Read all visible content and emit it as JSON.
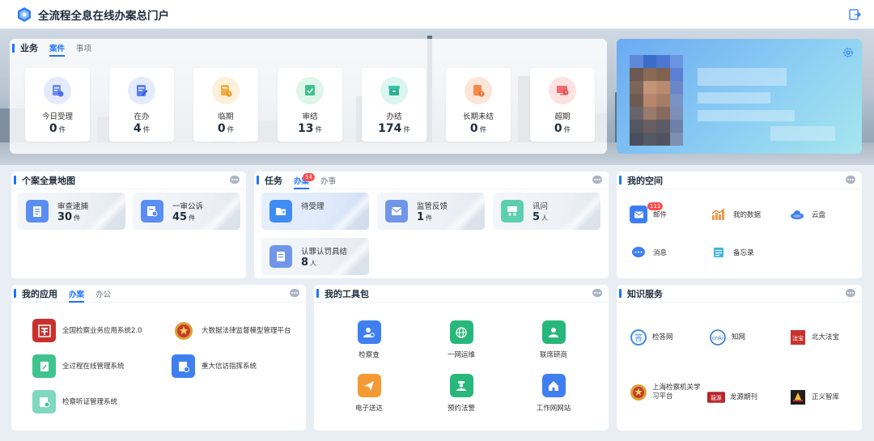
{
  "header": {
    "title": "全流程全息在线办案总门户",
    "logo_icon": "hexagon-logo-icon",
    "exit_icon": "logout-icon"
  },
  "business": {
    "title": "业务",
    "tabs": [
      "案件",
      "事项"
    ],
    "stats": [
      {
        "label": "今日受理",
        "value": "0",
        "unit": "件",
        "color": "#6b8cf2"
      },
      {
        "label": "在办",
        "value": "4",
        "unit": "件",
        "color": "#5b7ff0"
      },
      {
        "label": "临期",
        "value": "0",
        "unit": "件",
        "color": "#f0b046"
      },
      {
        "label": "审结",
        "value": "13",
        "unit": "件",
        "color": "#3ec28f"
      },
      {
        "label": "办结",
        "value": "174",
        "unit": "件",
        "color": "#38c3a4"
      },
      {
        "label": "长期未结",
        "value": "0",
        "unit": "件",
        "color": "#f48a4a"
      },
      {
        "label": "超期",
        "value": "0",
        "unit": "件",
        "color": "#f06b6b"
      }
    ]
  },
  "case_map": {
    "title": "个案全景地图",
    "items": [
      {
        "label": "审查逮捕",
        "value": "30",
        "unit": "件"
      },
      {
        "label": "一审公诉",
        "value": "45",
        "unit": "件"
      }
    ]
  },
  "tasks": {
    "title": "任务",
    "tabs": [
      "办案",
      "办事"
    ],
    "tab_badge": "14",
    "items": [
      {
        "label": "待受理",
        "value": "",
        "unit": ""
      },
      {
        "label": "监管反馈",
        "value": "1",
        "unit": "件"
      },
      {
        "label": "讯问",
        "value": "5",
        "unit": "人"
      },
      {
        "label": "认罪认罚具结",
        "value": "8",
        "unit": "人"
      }
    ]
  },
  "my_space": {
    "title": "我的空间",
    "items": [
      {
        "label": "邮件",
        "badge": "111"
      },
      {
        "label": "我的数据"
      },
      {
        "label": "云盘"
      },
      {
        "label": "消息"
      },
      {
        "label": "备忘录"
      }
    ]
  },
  "my_apps": {
    "title": "我的应用",
    "tabs": [
      "办案",
      "办公"
    ],
    "items": [
      {
        "label": "全国检察业务应用系统2.0"
      },
      {
        "label": "大数据法律监督模型管理平台"
      },
      {
        "label": "全过程在线管理系统"
      },
      {
        "label": "重大信访指挥系统"
      },
      {
        "label": "检察听证管理系统"
      }
    ]
  },
  "toolkit": {
    "title": "我的工具包",
    "items": [
      {
        "label": "检察查"
      },
      {
        "label": "一网运维"
      },
      {
        "label": "联席研商"
      },
      {
        "label": "电子送达"
      },
      {
        "label": "预约法警"
      },
      {
        "label": "工作网网站"
      }
    ]
  },
  "knowledge": {
    "title": "知识服务",
    "items": [
      {
        "label": "检答网",
        "icon_text": "答"
      },
      {
        "label": "知网",
        "icon_text": "cnki"
      },
      {
        "label": "北大法宝",
        "icon_text": "法宝"
      },
      {
        "label": "上海检察机关学习平台"
      },
      {
        "label": "龙源期刊",
        "icon_text": "龍源"
      },
      {
        "label": "正义智库"
      }
    ]
  }
}
